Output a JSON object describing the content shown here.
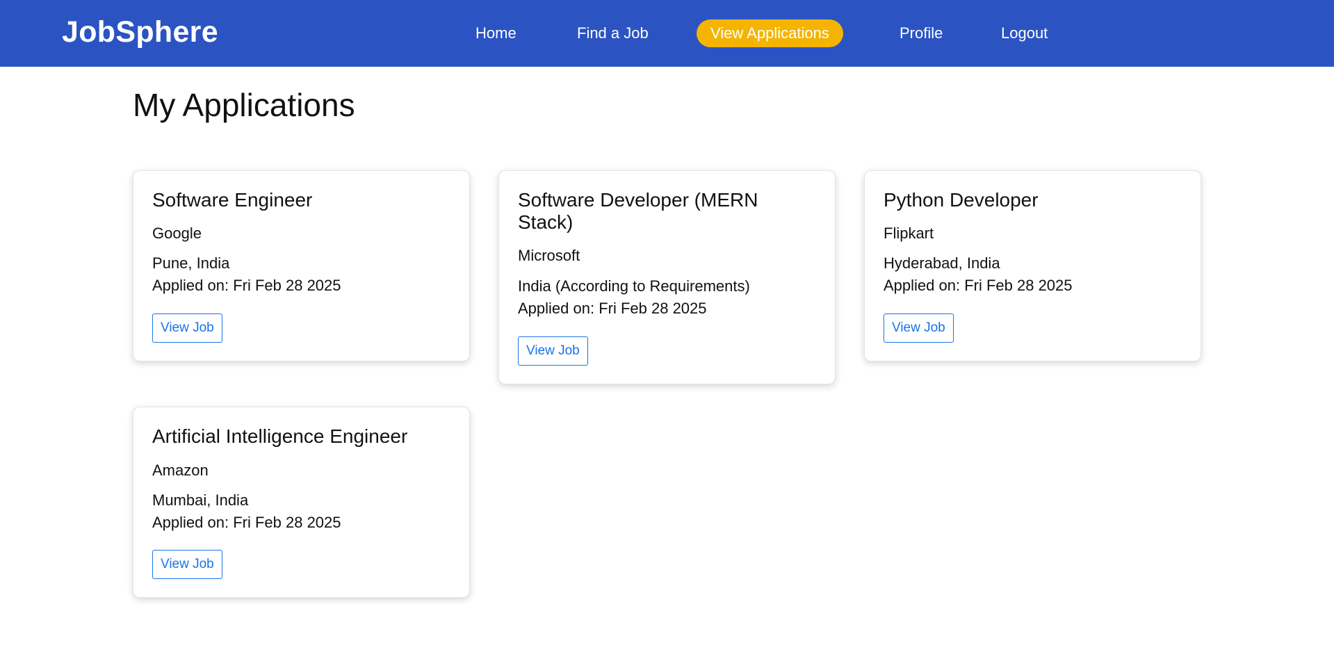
{
  "brand": "JobSphere",
  "nav": {
    "home": "Home",
    "find_job": "Find a Job",
    "view_applications": "View Applications",
    "profile": "Profile",
    "logout": "Logout",
    "active": "View Applications"
  },
  "colors": {
    "navbar": "#2b53c2",
    "active_nav": "#f4b400",
    "button_border": "#1a73e8"
  },
  "page_title": "My Applications",
  "applications": [
    {
      "title": "Software Engineer",
      "company": "Google",
      "location": "Pune, India",
      "applied": "Applied on: Fri Feb 28 2025",
      "button": "View Job"
    },
    {
      "title": "Software Developer (MERN Stack)",
      "company": "Microsoft",
      "location": "India (According to Requirements)",
      "applied": "Applied on: Fri Feb 28 2025",
      "button": "View Job"
    },
    {
      "title": "Python Developer",
      "company": "Flipkart",
      "location": "Hyderabad, India",
      "applied": "Applied on: Fri Feb 28 2025",
      "button": "View Job"
    },
    {
      "title": "Artificial Intelligence Engineer",
      "company": "Amazon",
      "location": "Mumbai, India",
      "applied": "Applied on: Fri Feb 28 2025",
      "button": "View Job"
    }
  ]
}
